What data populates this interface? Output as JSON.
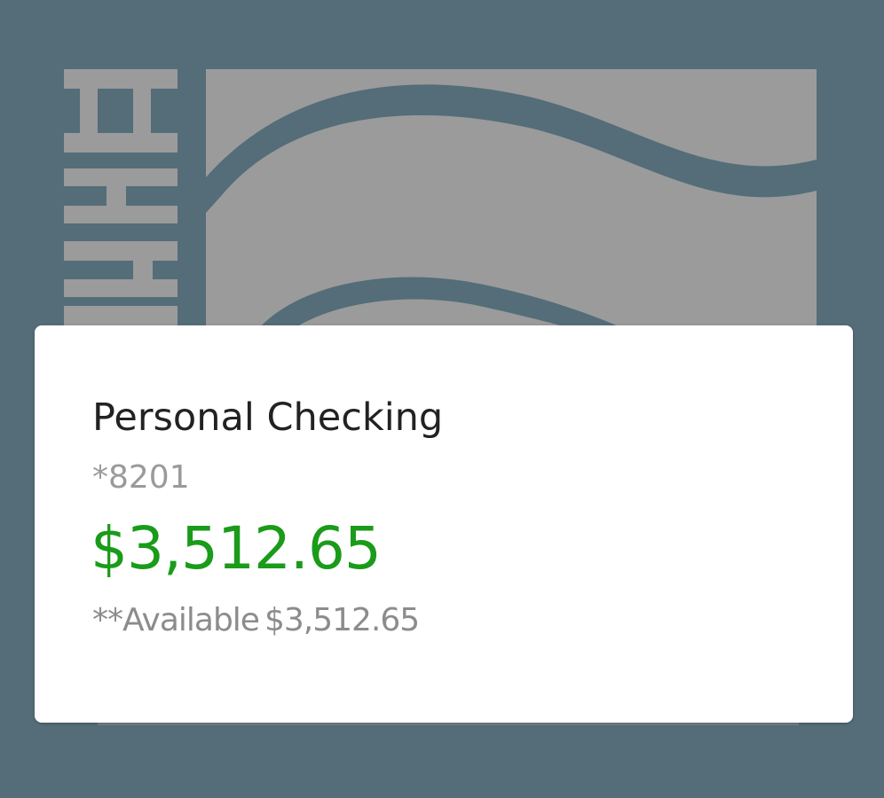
{
  "colors": {
    "background": "#546d78",
    "logo_gray": "#9b9b9b",
    "card": "#ffffff",
    "account_name": "#222222",
    "muted_text": "#9a9a9a",
    "balance_green": "#1a9b1a"
  },
  "logo": {
    "icon": "bank-logo-watermark"
  },
  "account": {
    "name": "Personal Checking",
    "number": "*8201",
    "balance": "$3,512.65",
    "available_label": "**Available",
    "available_value": "$3,512.65"
  }
}
